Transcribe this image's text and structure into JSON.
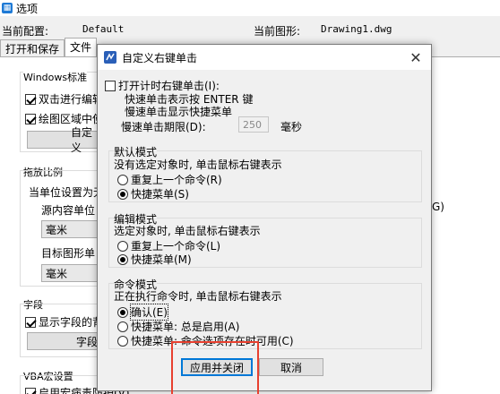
{
  "window": {
    "title": "选项"
  },
  "info": {
    "config_label": "当前配置:",
    "config_value": "Default",
    "drawing_label": "当前图形:",
    "drawing_value": "Drawing1.dwg"
  },
  "tabs": [
    "打开和保存",
    "文件"
  ],
  "background": {
    "windows_std": "Windows标准",
    "dblclick_edit": "双击进行编辑",
    "draw_area": "绘图区域中使",
    "custom_btn": "自定义",
    "drag_scale": "拖放比例",
    "unit_set": "当单位设置为无",
    "src_unit": "源内容单位",
    "src_value": "毫米",
    "target_unit": "目标图形单",
    "target_value": "毫米",
    "field": "字段",
    "show_field": "显示字段的背",
    "field_btn": "字段",
    "vba": "VBA宏设置",
    "vba_check": "启用宏病毒防护(V)",
    "right_fragment": "G)"
  },
  "dialog": {
    "title": "自定义右键单击",
    "close_glyph": "✕",
    "timing_check": "打开计时右键单击(I):",
    "quick_line": "快速单击表示按 ENTER 键",
    "slow_line": "慢速单击显示快捷菜单",
    "duration_label": "慢速单击期限(D):",
    "duration_value": "250",
    "duration_unit": "毫秒",
    "default_mode": {
      "title": "默认模式",
      "desc": "没有选定对象时, 单击鼠标右键表示",
      "opt1": "重复上一个命令(R)",
      "opt2": "快捷菜单(S)"
    },
    "edit_mode": {
      "title": "编辑模式",
      "desc": "选定对象时, 单击鼠标右键表示",
      "opt1": "重复上一个命令(L)",
      "opt2": "快捷菜单(M)"
    },
    "command_mode": {
      "title": "命令模式",
      "desc": "正在执行命令时, 单击鼠标右键表示",
      "opt1": "确认(E)",
      "opt2": "快捷菜单: 总是启用(A)",
      "opt3": "快捷菜单: 命令选项存在时可用(C)"
    },
    "apply_label": "应用并关闭",
    "cancel_label": "取消"
  },
  "colors": {
    "highlight": "#e8402f",
    "accent": "#0078d7"
  }
}
